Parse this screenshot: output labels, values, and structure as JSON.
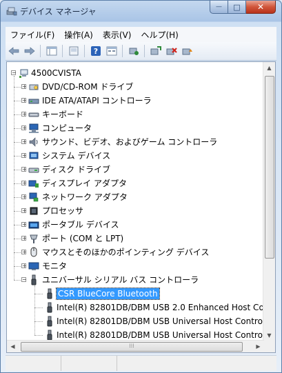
{
  "window": {
    "title": "デバイス マネージャ"
  },
  "caption": {
    "minimize": "—",
    "maximize": "□",
    "close": "✕"
  },
  "menu": [
    {
      "label": "ファイル(F)"
    },
    {
      "label": "操作(A)"
    },
    {
      "label": "表示(V)"
    },
    {
      "label": "ヘルプ(H)"
    }
  ],
  "toolbar": [
    "back-icon",
    "forward-icon",
    "properties-icon",
    "scan-icon",
    "help-icon",
    "view-icon",
    "update-driver-icon",
    "disable-icon",
    "uninstall-icon",
    "scan-hardware-icon"
  ],
  "tree": {
    "root": "4500CVISTA",
    "categories": [
      {
        "label": "DVD/CD-ROM ドライブ",
        "icon": "dvd-drive-icon"
      },
      {
        "label": "IDE ATA/ATAPI コントローラ",
        "icon": "ide-controller-icon"
      },
      {
        "label": "キーボード",
        "icon": "keyboard-icon"
      },
      {
        "label": "コンピュータ",
        "icon": "computer-icon"
      },
      {
        "label": "サウンド、ビデオ、およびゲーム コントローラ",
        "icon": "sound-icon"
      },
      {
        "label": "システム デバイス",
        "icon": "system-devices-icon"
      },
      {
        "label": "ディスク ドライブ",
        "icon": "disk-drive-icon"
      },
      {
        "label": "ディスプレイ アダプタ",
        "icon": "display-adapter-icon"
      },
      {
        "label": "ネットワーク アダプタ",
        "icon": "network-adapter-icon"
      },
      {
        "label": "プロセッサ",
        "icon": "processor-icon"
      },
      {
        "label": "ポータブル デバイス",
        "icon": "portable-device-icon"
      },
      {
        "label": "ポート (COM と LPT)",
        "icon": "port-icon"
      },
      {
        "label": "マウスとそのほかのポインティング デバイス",
        "icon": "mouse-icon"
      },
      {
        "label": "モニタ",
        "icon": "monitor-icon"
      },
      {
        "label": "ユニバーサル シリアル バス コントローラ",
        "icon": "usb-icon"
      }
    ],
    "usb_children": [
      {
        "label": "CSR BlueCore Bluetooth",
        "selected": true
      },
      {
        "label": "Intel(R) 82801DB/DBM USB 2.0 Enhanced Host Co"
      },
      {
        "label": "Intel(R) 82801DB/DBM USB Universal Host Contro"
      },
      {
        "label": "Intel(R) 82801DB/DBM USB Universal Host Contro"
      }
    ]
  },
  "colors": {
    "selection": "#3399ff",
    "title_bar": "#a9c4e6"
  }
}
